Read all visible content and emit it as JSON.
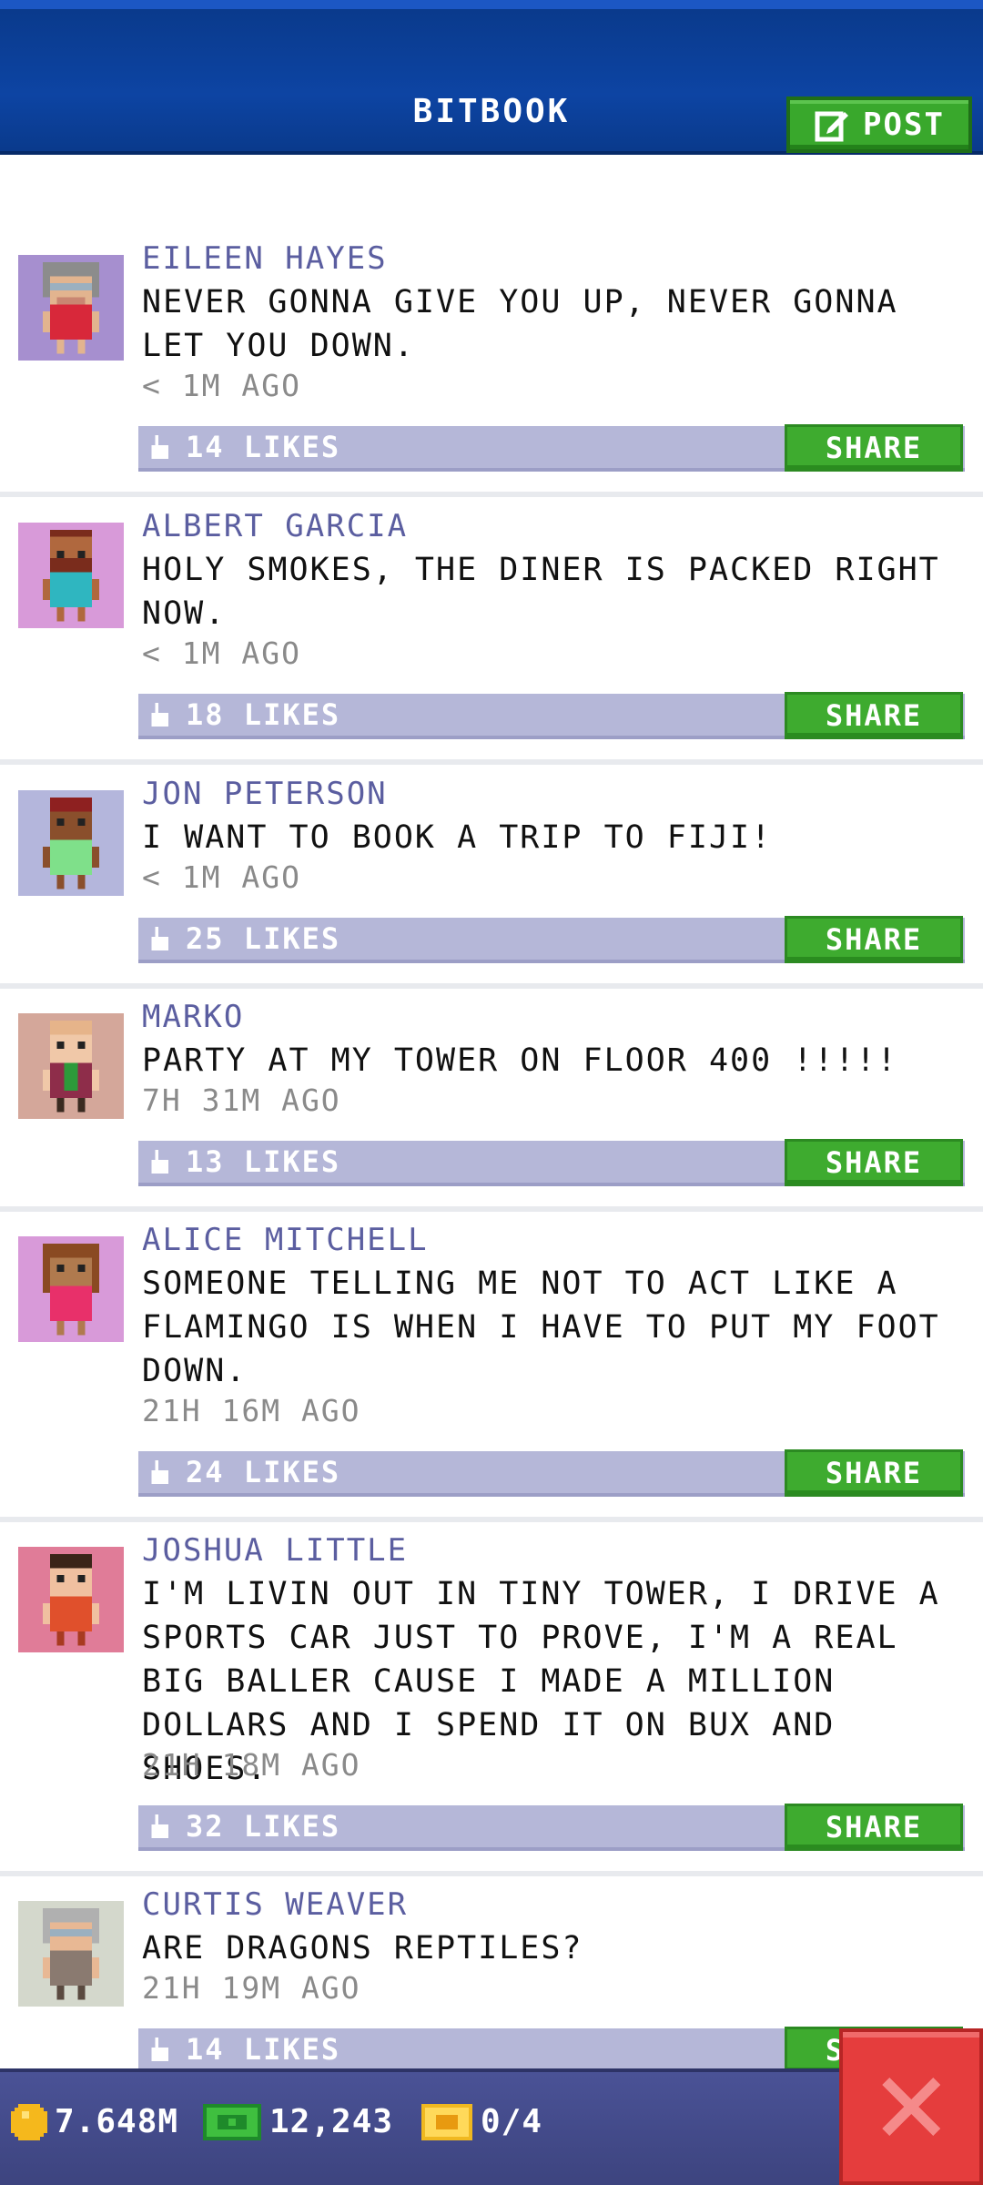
{
  "header": {
    "title": "BITBOOK",
    "post_label": "POST"
  },
  "posts": [
    {
      "author": "EILEEN HAYES",
      "message": "NEVER GONNA GIVE YOU UP, NEVER GONNA LET YOU DOWN.",
      "time": "< 1M AGO",
      "likes": "14 LIKES",
      "share_label": "SHARE",
      "avatar_bg": "#a68fcf"
    },
    {
      "author": "ALBERT GARCIA",
      "message": "HOLY SMOKES, THE DINER IS PACKED RIGHT NOW.",
      "time": "< 1M AGO",
      "likes": "18 LIKES",
      "share_label": "SHARE",
      "avatar_bg": "#d89ad9"
    },
    {
      "author": "JON PETERSON",
      "message": "I WANT TO BOOK A TRIP TO FIJI!",
      "time": "< 1M AGO",
      "likes": "25 LIKES",
      "share_label": "SHARE",
      "avatar_bg": "#b4b6dc"
    },
    {
      "author": "MARKO",
      "message": "PARTY AT MY TOWER ON FLOOR 400 !!!!!",
      "time": "7H 31M AGO",
      "likes": "13 LIKES",
      "share_label": "SHARE",
      "avatar_bg": "#d4a79a"
    },
    {
      "author": "ALICE MITCHELL",
      "message": "SOMEONE TELLING ME NOT TO ACT LIKE A FLAMINGO IS WHEN I HAVE TO PUT MY FOOT DOWN.",
      "time": "21H 16M AGO",
      "likes": "24 LIKES",
      "share_label": "SHARE",
      "avatar_bg": "#d89ad9"
    },
    {
      "author": "JOSHUA LITTLE",
      "message": "I'M LIVIN OUT IN TINY TOWER, I DRIVE A SPORTS CAR JUST TO PROVE, I'M A REAL BIG BALLER CAUSE I MADE A MILLION DOLLARS AND I SPEND IT ON BUX AND SHOES.",
      "time": "21H 18M AGO",
      "likes": "32 LIKES",
      "share_label": "SHARE",
      "avatar_bg": "#e07c98"
    },
    {
      "author": "CURTIS WEAVER",
      "message": "ARE DRAGONS REPTILES?",
      "time": "21H 19M AGO",
      "likes": "14 LIKES",
      "share_label": "SHARE",
      "avatar_bg": "#d4d8cc"
    }
  ],
  "status_bar": {
    "coins": "7.648M",
    "bux": "12,243",
    "tickets": "0/4"
  },
  "colors": {
    "header_blue": "#0d44a3",
    "share_green": "#3eab2f",
    "likes_bar": "#b5b7d8",
    "author_text": "#5b5ea0",
    "close_red": "#e53d3d"
  },
  "icons": {
    "post": "edit-icon",
    "like": "thumbs-up-icon",
    "coins": "coin-icon",
    "bux": "bux-icon",
    "tickets": "ticket-icon",
    "close": "close-icon"
  }
}
